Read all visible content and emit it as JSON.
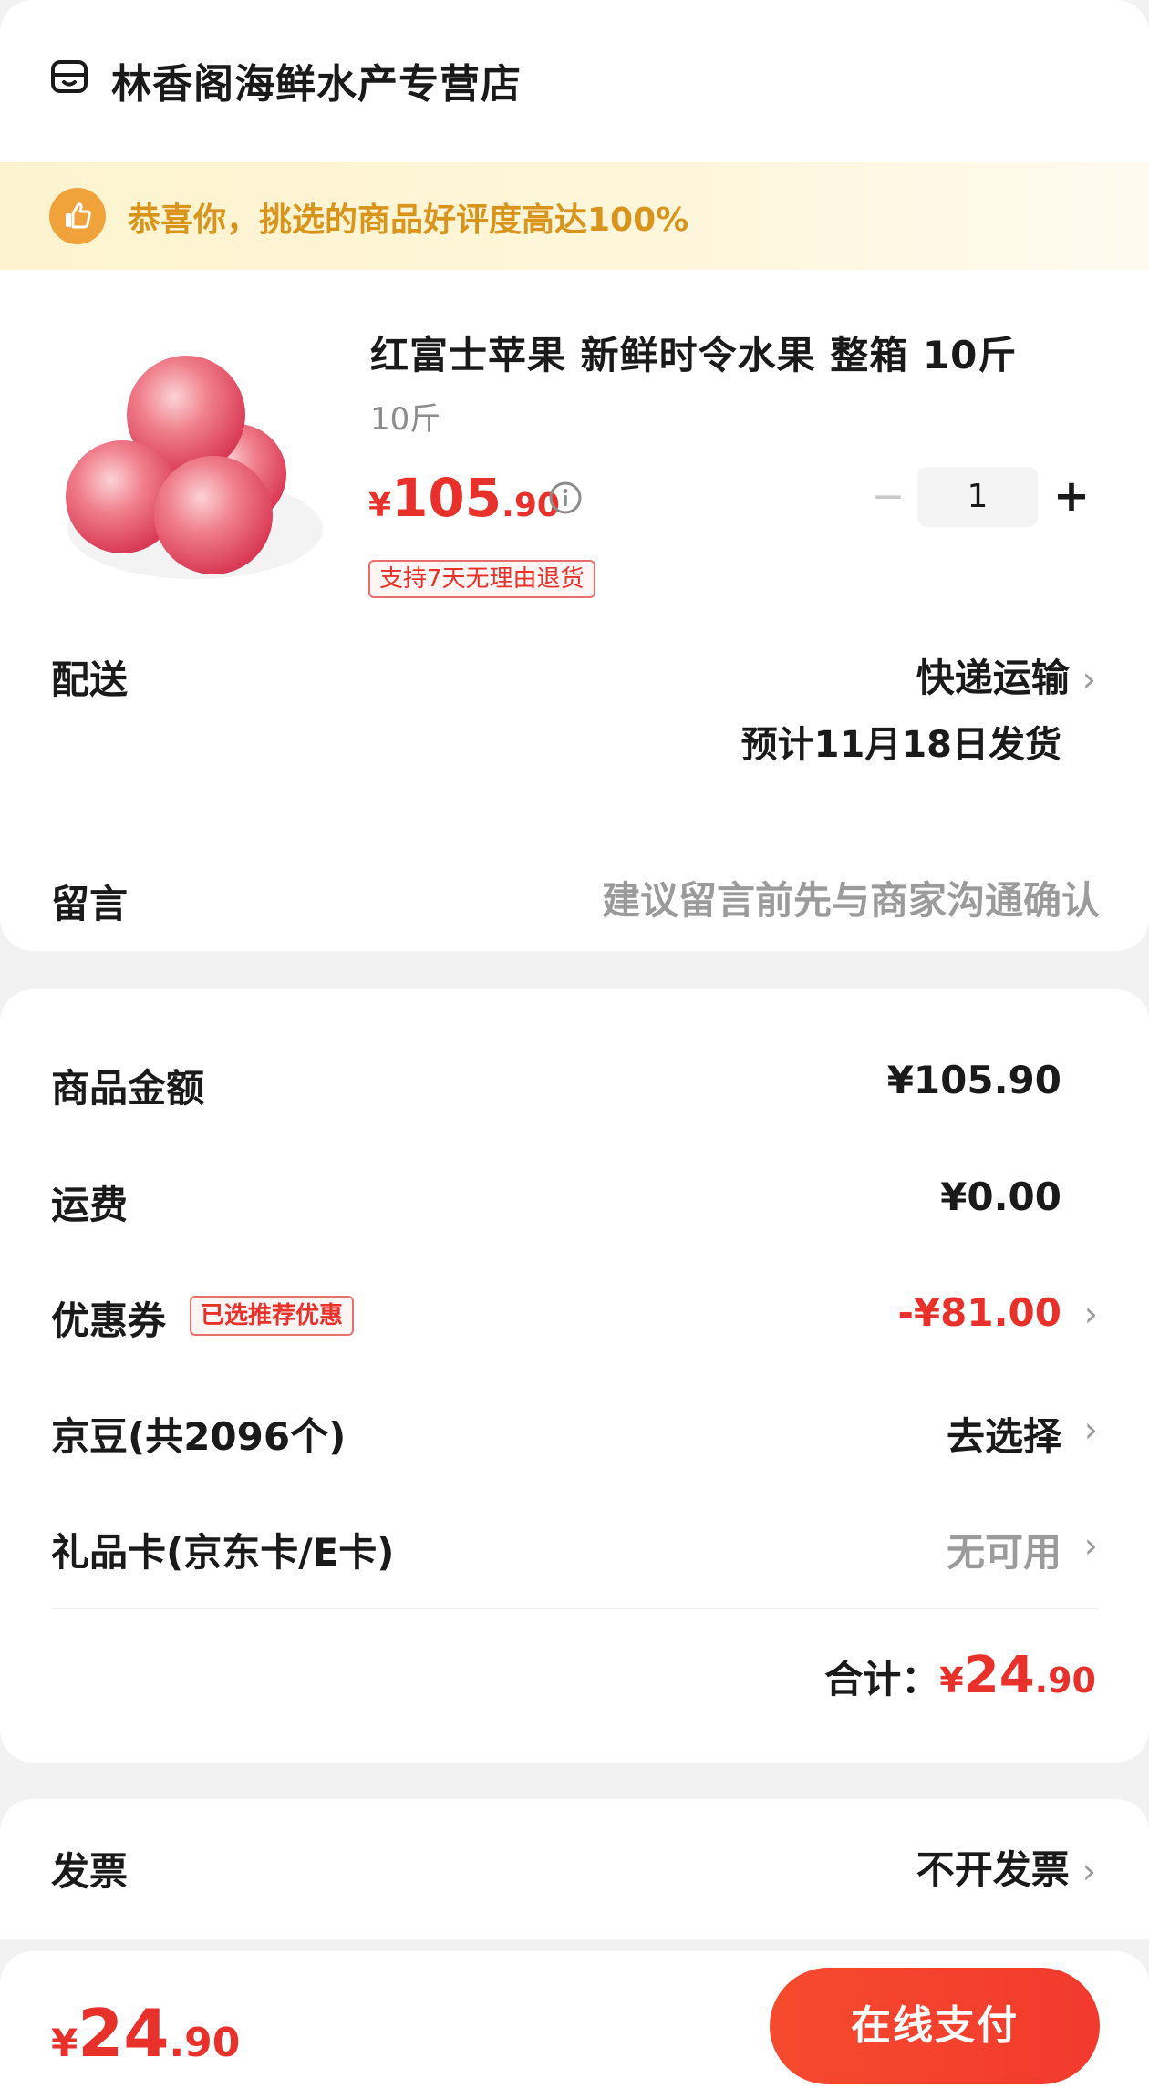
{
  "shop": {
    "name": "林香阁海鲜水产专营店",
    "icon": "store-icon"
  },
  "promo": {
    "icon": "thumbs-up-icon",
    "text": "恭喜你，挑选的商品好评度高达100%"
  },
  "product": {
    "title": "红富士苹果 新鲜时令水果 整箱 10斤",
    "spec": "10斤",
    "price_symbol": "¥",
    "price_int": "105",
    "price_dec": ".90",
    "info_icon": "info-icon",
    "quantity": "1",
    "minus_label": "−",
    "plus_label": "+",
    "return_badge": "支持7天无理由退货"
  },
  "delivery": {
    "label": "配送",
    "method": "快递运输",
    "date": "预计11月18日发货",
    "chevron": "›"
  },
  "message": {
    "label": "留言",
    "placeholder": "建议留言前先与商家沟通确认"
  },
  "costs": {
    "subtotal_label": "商品金额",
    "subtotal_value": "¥105.90",
    "shipping_label": "运费",
    "shipping_value": "¥0.00",
    "coupon_label": "优惠券",
    "coupon_badge": "已选推荐优惠",
    "coupon_value": "-¥81.00",
    "beans_label": "京豆(共2096个)",
    "beans_value": "去选择",
    "giftcard_label": "礼品卡(京东卡/E卡)",
    "giftcard_value": "无可用",
    "chevron": "›",
    "total_label": "合计：",
    "total_symbol": "¥",
    "total_int": "24",
    "total_dec": ".90"
  },
  "invoice": {
    "label": "发票",
    "value": "不开发票"
  },
  "footer": {
    "price_symbol": "¥",
    "price_int": "24",
    "price_dec": ".90",
    "pay_label": "在线支付"
  },
  "colors": {
    "accent": "#e8312a",
    "promo_text": "#d9941c",
    "pay_button": "#f43f2e"
  }
}
